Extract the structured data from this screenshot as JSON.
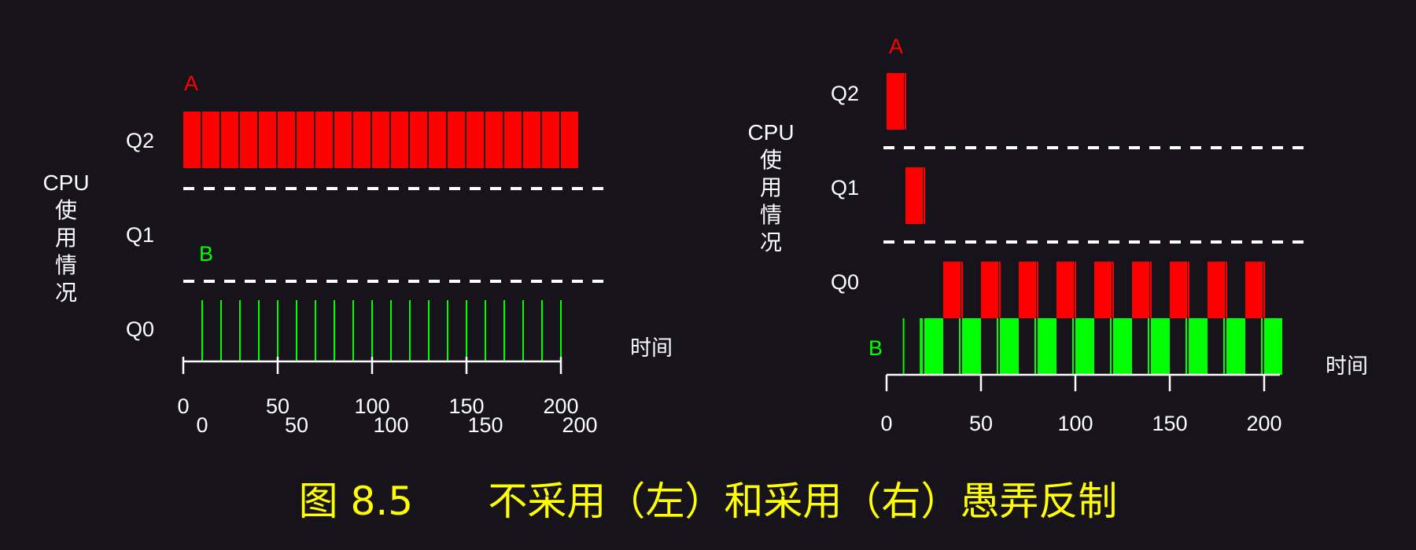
{
  "colors": {
    "background": "#16131b",
    "job_a": "#ff0000",
    "job_b": "#00ff00",
    "text": "#ffffff",
    "caption": "#ffff00"
  },
  "caption": "图 8.5      不采用（左）和采用（右）愚弄反制",
  "left_panel": {
    "ylabel_lines": [
      "CPU",
      "使",
      "用",
      "情",
      "况"
    ],
    "queue_labels": [
      "Q2",
      "Q1",
      "Q0"
    ],
    "job_a_label": "A",
    "job_b_label": "B",
    "xlabel": "",
    "ticks": [
      "0",
      "50",
      "100",
      "150",
      "200"
    ],
    "ticks_offset": [
      "0",
      "50",
      "100",
      "150",
      "200"
    ],
    "a_blocks": [
      0,
      10,
      20,
      30,
      40,
      50,
      60,
      70,
      80,
      90,
      100,
      110,
      120,
      130,
      140,
      150,
      160,
      170,
      180,
      190,
      200
    ],
    "b_spikes": [
      10,
      20,
      30,
      40,
      50,
      60,
      70,
      80,
      90,
      100,
      110,
      120,
      130,
      140,
      150,
      160,
      170,
      180,
      190,
      200
    ]
  },
  "right_panel": {
    "ylabel_lines": [
      "CPU",
      "使",
      "用",
      "情",
      "况"
    ],
    "queue_labels": [
      "Q2",
      "Q1",
      "Q0"
    ],
    "job_a_label": "A",
    "job_b_label": "B",
    "xlabel": "时间",
    "ticks": [
      "0",
      "50",
      "100",
      "150",
      "200"
    ],
    "a_q2": {
      "start": 0,
      "end": 10
    },
    "a_q1": {
      "start": 10,
      "end": 20
    },
    "a_q0": [
      [
        30,
        40
      ],
      [
        50,
        60
      ],
      [
        70,
        80
      ],
      [
        90,
        100
      ],
      [
        110,
        120
      ],
      [
        130,
        140
      ],
      [
        150,
        160
      ],
      [
        170,
        180
      ],
      [
        190,
        200
      ]
    ],
    "b_spikes": [
      9,
      18
    ],
    "b_blocks": [
      [
        20,
        30
      ],
      [
        40,
        50
      ],
      [
        60,
        70
      ],
      [
        80,
        90
      ],
      [
        100,
        110
      ],
      [
        120,
        130
      ],
      [
        140,
        150
      ],
      [
        160,
        170
      ],
      [
        180,
        190
      ],
      [
        200,
        210
      ]
    ]
  },
  "left_time_label": "时间"
}
